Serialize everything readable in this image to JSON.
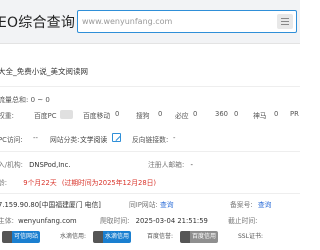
{
  "header": {
    "logo": "EO综合查询",
    "search_placeholder": "www.wenyunfang.com"
  },
  "site": {
    "title": "大全_免费小说_美文阅读网"
  },
  "weight": {
    "label": "流量总和: 0 ~ 0"
  },
  "engines": {
    "label": "权重:",
    "items": [
      {
        "name": "百度PC",
        "value": "0"
      },
      {
        "name": "百度移动",
        "value": "0"
      },
      {
        "name": "搜狗",
        "value": "0"
      },
      {
        "name": "必应",
        "value": "0"
      },
      {
        "name": "360",
        "value": "0"
      },
      {
        "name": "神马",
        "value": "0"
      },
      {
        "name": "PR",
        "value": ""
      }
    ]
  },
  "access": {
    "ip_label": "PC访问:",
    "ip_value": "--",
    "category_label": "网站分类:",
    "category_value": "文学阅读",
    "reverse_label": "反向链接数:",
    "reverse_value": "-"
  },
  "registrar": {
    "label": "入/机构:",
    "value": "DNSPod,Inc.",
    "email_label": "注册人邮箱:",
    "email_value": "-"
  },
  "age": {
    "label": "龄:",
    "value": "9个月22天",
    "note": "(过期时间为2025年12月28日)"
  },
  "server": {
    "ip": "7.159.90.80[中国福建厦门 电信]",
    "same_ip_label": "同IP网站:",
    "same_ip_link": "查询",
    "beian_label": "备案号:",
    "beian_link": "查询"
  },
  "domain_row": {
    "label": "主体:",
    "value": "wenyunfang.com",
    "time_label": "爬取时间:",
    "time_value": "2025-03-04 21:51:59",
    "expire_label": "截止时间:",
    "expire_value": ""
  },
  "badges": [
    {
      "icon": "shield-icon",
      "text": "可信网站",
      "style": "blue"
    },
    {
      "icon": "",
      "text": "水滴信用:",
      "style": "plain"
    },
    {
      "icon": "water-drop-icon",
      "text": "水滴信用",
      "style": "blue"
    },
    {
      "icon": "",
      "text": "百度信誉:",
      "style": "plain"
    },
    {
      "icon": "baidu-icon",
      "text": "百度信用",
      "style": "gray"
    },
    {
      "icon": "",
      "text": "SSL证书:",
      "style": "plain"
    }
  ],
  "colors": {
    "accent": "#2f8fd8",
    "link": "#2f6fd8",
    "warning": "#d9342b"
  }
}
